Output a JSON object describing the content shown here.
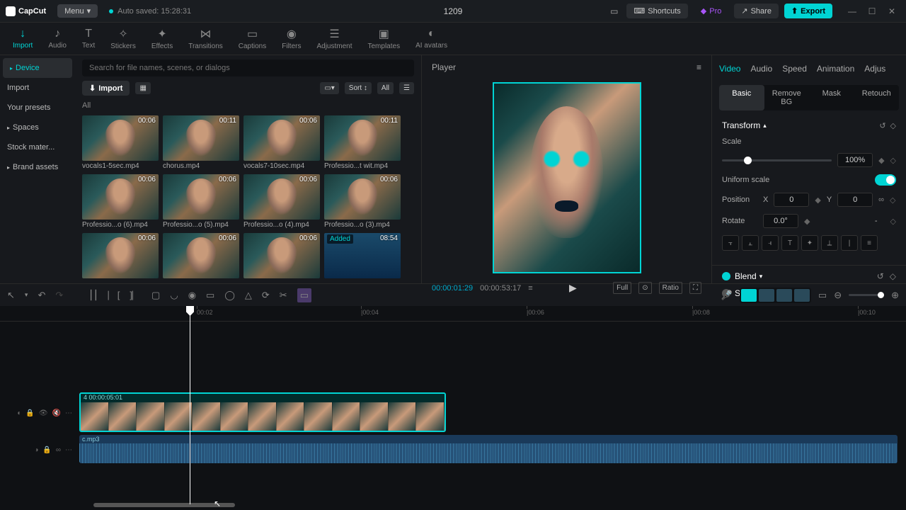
{
  "titlebar": {
    "app_name": "CapCut",
    "menu_label": "Menu",
    "autosave": "Auto saved: 15:28:31",
    "project_title": "1209",
    "shortcuts": "Shortcuts",
    "pro": "Pro",
    "share": "Share",
    "export": "Export"
  },
  "toolbar_tabs": [
    {
      "label": "Import",
      "icon": "↓",
      "active": true
    },
    {
      "label": "Audio",
      "icon": "♪"
    },
    {
      "label": "Text",
      "icon": "T"
    },
    {
      "label": "Stickers",
      "icon": "✧"
    },
    {
      "label": "Effects",
      "icon": "✦"
    },
    {
      "label": "Transitions",
      "icon": "⋈"
    },
    {
      "label": "Captions",
      "icon": "▭"
    },
    {
      "label": "Filters",
      "icon": "◉"
    },
    {
      "label": "Adjustment",
      "icon": "☰"
    },
    {
      "label": "Templates",
      "icon": "▣"
    },
    {
      "label": "AI avatars",
      "icon": "◐"
    }
  ],
  "left_nav": [
    {
      "label": "Device",
      "active": true,
      "expandable": true
    },
    {
      "label": "Import"
    },
    {
      "label": "Your presets"
    },
    {
      "label": "Spaces",
      "expandable": true
    },
    {
      "label": "Stock mater..."
    },
    {
      "label": "Brand assets",
      "expandable": true
    }
  ],
  "search": {
    "placeholder": "Search for file names, scenes, or dialogs"
  },
  "import_bar": {
    "import": "Import",
    "sort": "Sort",
    "all": "All"
  },
  "all_label": "All",
  "thumbs": [
    {
      "name": "vocals1-5sec.mp4",
      "dur": "00:06"
    },
    {
      "name": "chorus.mp4",
      "dur": "00:11"
    },
    {
      "name": "vocals7-10sec.mp4",
      "dur": "00:06"
    },
    {
      "name": "Professio...t wit.mp4",
      "dur": "00:11"
    },
    {
      "name": "Professio...o (6).mp4",
      "dur": "00:06"
    },
    {
      "name": "Professio...o (5).mp4",
      "dur": "00:06"
    },
    {
      "name": "Professio...o (4).mp4",
      "dur": "00:06"
    },
    {
      "name": "Professio...o (3).mp4",
      "dur": "00:06"
    },
    {
      "name": "",
      "dur": "00:06"
    },
    {
      "name": "",
      "dur": "00:06"
    },
    {
      "name": "",
      "dur": "00:06"
    },
    {
      "name": "",
      "dur": "08:54",
      "added": "Added",
      "audio": true
    }
  ],
  "player": {
    "title": "Player",
    "time_current": "00:00:01:29",
    "time_total": "00:00:53:17",
    "full": "Full",
    "ratio": "Ratio"
  },
  "right_tabs": [
    {
      "label": "Video",
      "active": true
    },
    {
      "label": "Audio"
    },
    {
      "label": "Speed"
    },
    {
      "label": "Animation"
    },
    {
      "label": "Adjus"
    }
  ],
  "sub_tabs": [
    {
      "label": "Basic",
      "active": true
    },
    {
      "label": "Remove BG"
    },
    {
      "label": "Mask"
    },
    {
      "label": "Retouch"
    }
  ],
  "props": {
    "transform_label": "Transform",
    "scale_label": "Scale",
    "scale_value": "100%",
    "uniform_label": "Uniform scale",
    "position_label": "Position",
    "pos_x_label": "X",
    "pos_x": "0",
    "pos_y_label": "Y",
    "pos_y": "0",
    "rotate_label": "Rotate",
    "rotate_value": "0.0°",
    "rotate_dash": "-",
    "blend_label": "Blend",
    "stabilize_label": "Stabilize"
  },
  "ruler": [
    {
      "label": "00:02",
      "pos": 278
    },
    {
      "label": "|00:04",
      "pos": 510
    },
    {
      "label": "|00:06",
      "pos": 744
    },
    {
      "label": "|00:08",
      "pos": 978
    },
    {
      "label": "|00:10",
      "pos": 1212
    }
  ],
  "timeline": {
    "video_clip_label": "4  00:00:05:01",
    "audio_clip_label": "c.mp3"
  }
}
